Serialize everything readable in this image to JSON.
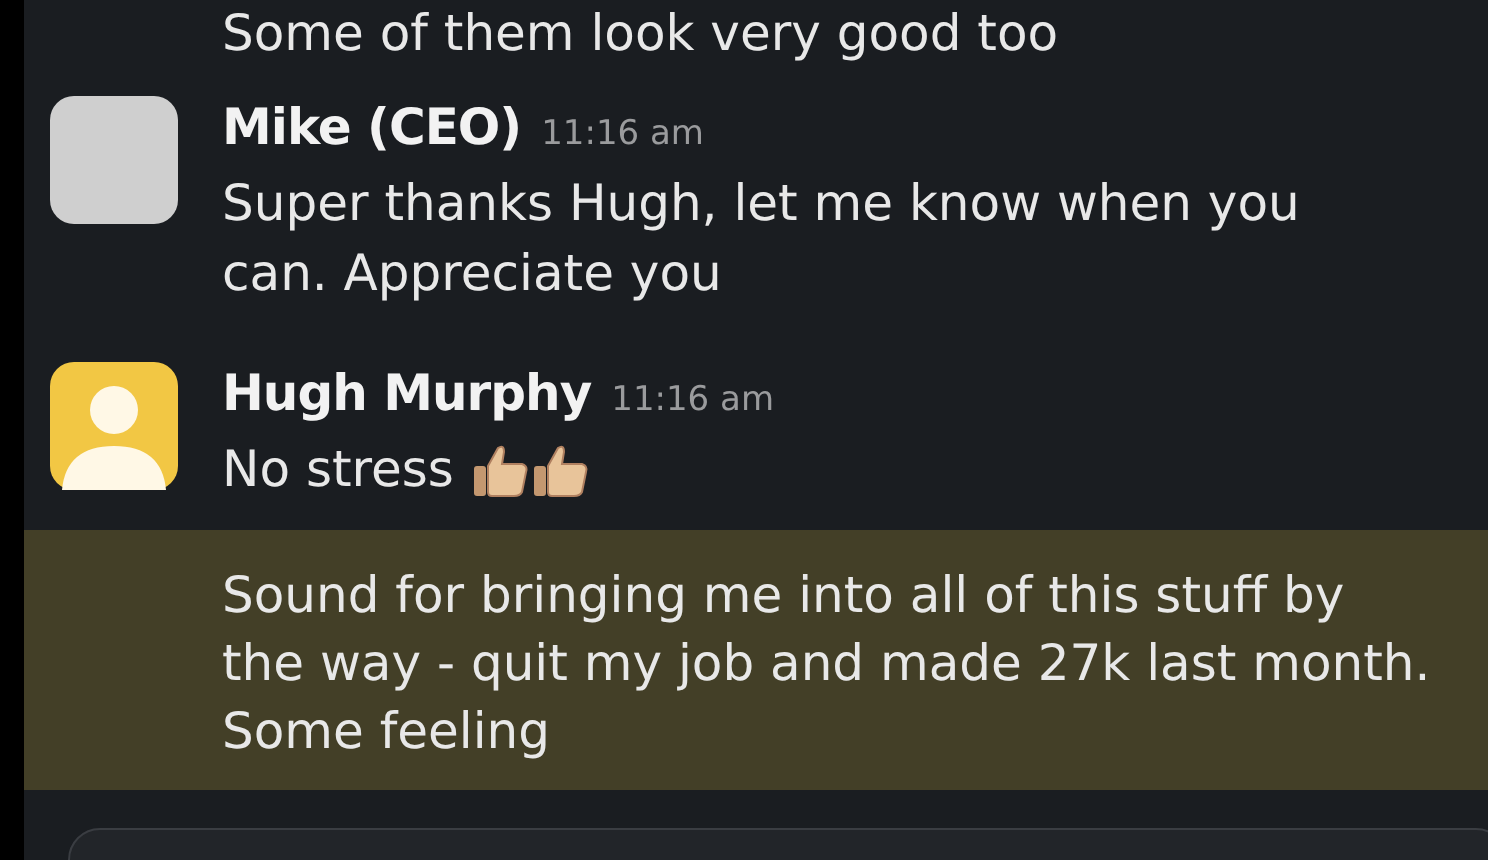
{
  "messages": [
    {
      "kind": "continuation",
      "text": "Some of them look very good too",
      "highlighted": false
    },
    {
      "kind": "full",
      "avatar": {
        "kind": "photo"
      },
      "author": "Mike (CEO)",
      "time": "11:16 am",
      "text": "Super thanks Hugh, let me know when you can. Appreciate you",
      "highlighted": false
    },
    {
      "kind": "full",
      "avatar": {
        "kind": "default"
      },
      "author": "Hugh Murphy",
      "time": "11:16 am",
      "text": "No stress",
      "emoji": [
        {
          "kind": "thumbs_up"
        },
        {
          "kind": "thumbs_up"
        }
      ],
      "highlighted": false
    },
    {
      "kind": "continuation",
      "text": "Sound for bringing me into all of this stuff by the way - quit my job and made 27k last month. Some feeling",
      "highlighted": true
    }
  ]
}
